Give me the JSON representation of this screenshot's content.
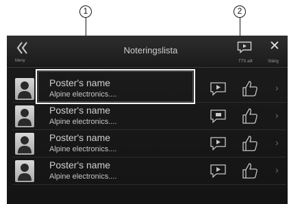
{
  "callouts": [
    "1",
    "2"
  ],
  "topbar": {
    "back_label": "Meny",
    "title": "Noteringslista",
    "tts_label": "TTS allt",
    "close_label": "Stäng"
  },
  "rows": [
    {
      "poster": "Poster's name",
      "company": "Alpine electronics...."
    },
    {
      "poster": "Poster's name",
      "company": "Alpine electronics...."
    },
    {
      "poster": "Poster's name",
      "company": "Alpine electronics...."
    },
    {
      "poster": "Poster's name",
      "company": "Alpine electronics...."
    }
  ],
  "icons": {
    "back": "double-chevron-left-icon",
    "tts": "speech-bubble-play-icon",
    "close": "close-icon",
    "avatar": "person-avatar-icon",
    "like": "thumbs-up-icon",
    "arrow": "chevron-right-icon"
  }
}
